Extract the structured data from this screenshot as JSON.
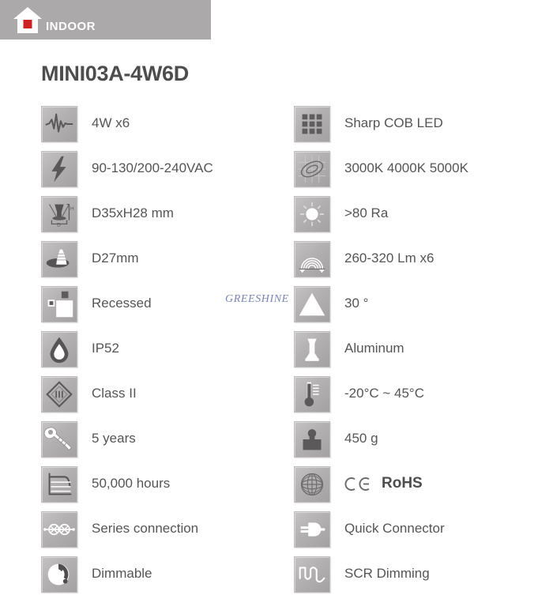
{
  "header": {
    "label": "INDOOR",
    "icon": "house-icon",
    "band_color": "#aba9a9",
    "house_body_color": "#ffffff",
    "house_square_color": "#cc2222",
    "label_color": "#ffffff"
  },
  "product": {
    "title": "MINI03A-4W6D",
    "title_color": "#4d4d4d"
  },
  "watermark": {
    "text": "GREESHINE",
    "color": "#7a86b8"
  },
  "theme": {
    "tile_light": "#c4c2c2",
    "tile_dark": "#a3a1a1",
    "label_color": "#555555",
    "page_background": "#ffffff"
  },
  "specs": {
    "left_column": [
      {
        "icon": "waveform-icon",
        "label": "4W x6"
      },
      {
        "icon": "lightning-bolt-icon",
        "label": "90-130/200-240VAC"
      },
      {
        "icon": "dimension-diagram-icon",
        "label": "D35xH28 mm"
      },
      {
        "icon": "cutout-cone-icon",
        "label": "D27mm"
      },
      {
        "icon": "recessed-mount-icon",
        "label": "Recessed"
      },
      {
        "icon": "water-drop-icon",
        "label": "IP52"
      },
      {
        "icon": "class-two-diamond-icon",
        "label": "Class II"
      },
      {
        "icon": "wrench-icon",
        "label": "5 years"
      },
      {
        "icon": "lifetime-graph-icon",
        "label": "50,000 hours"
      },
      {
        "icon": "series-connection-icon",
        "label": "Series connection"
      },
      {
        "icon": "dimmer-knob-icon",
        "label": "Dimmable"
      }
    ],
    "right_column": [
      {
        "icon": "led-chip-grid-icon",
        "label": "Sharp COB LED"
      },
      {
        "icon": "chromaticity-icon",
        "label": "3000K 4000K 5000K"
      },
      {
        "icon": "sun-cri-icon",
        "label": ">80 Ra"
      },
      {
        "icon": "lumen-arcs-icon",
        "label": "260-320 Lm x6"
      },
      {
        "icon": "beam-angle-icon",
        "label": "30 °"
      },
      {
        "icon": "fixture-body-icon",
        "label": "Aluminum"
      },
      {
        "icon": "thermometer-icon",
        "label": "-20°C ~ 45°C"
      },
      {
        "icon": "weight-icon",
        "label": "450 g"
      },
      {
        "icon": "globe-icon",
        "label": "CE RoHS",
        "ce_mark": "CE",
        "rohs_label": "RoHS"
      },
      {
        "icon": "plug-connector-icon",
        "label": "Quick Connector"
      },
      {
        "icon": "scr-waveform-icon",
        "label": "SCR Dimming"
      }
    ]
  }
}
